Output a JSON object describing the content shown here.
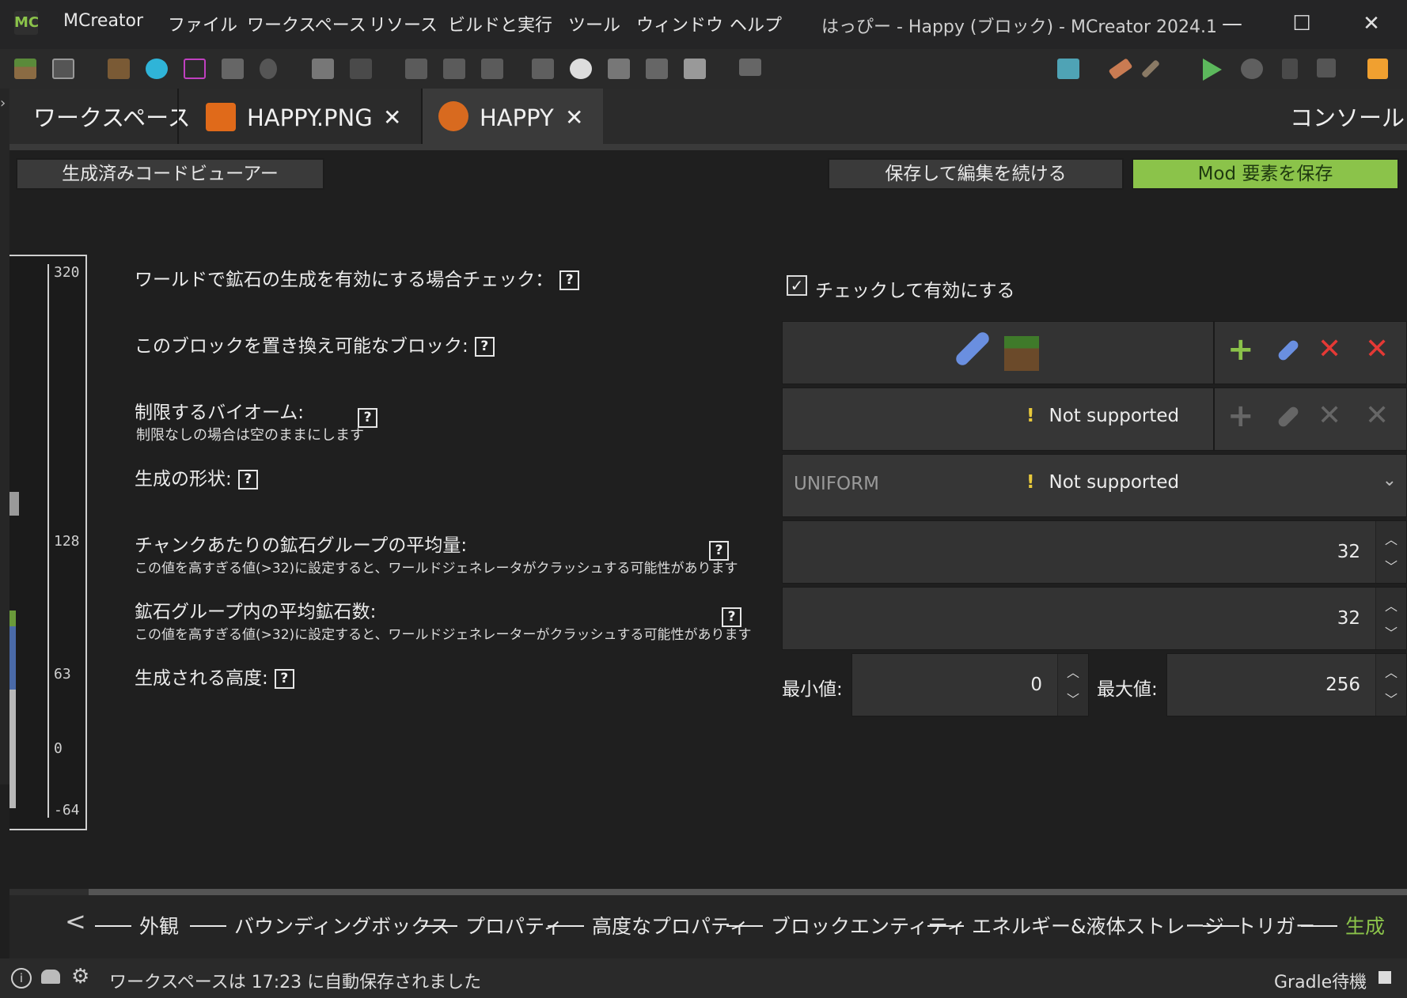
{
  "app": {
    "name": "MCreator",
    "window_title": "はっぴー - Happy (ブロック) - MCreator 2024.1",
    "logo": "MC"
  },
  "menu": [
    "ファイル",
    "ワークスペース",
    "リソース",
    "ビルドと実行",
    "ツール",
    "ウィンドウ",
    "ヘルプ"
  ],
  "window_controls": {
    "minimize": "—",
    "maximize": "☐",
    "close": "✕"
  },
  "tabs": {
    "workspace": "ワークスペース",
    "image": "HAPPY.PNG",
    "element": "HAPPY",
    "console": "コンソール",
    "close_glyph": "✕"
  },
  "actions": {
    "code_viewer": "生成済みコードビューアー",
    "save_continue": "保存して編集を続ける",
    "save_mod": "Mod 要素を保存"
  },
  "height_scale": [
    "320",
    "128",
    "63",
    "0",
    "-64"
  ],
  "form": {
    "enable_gen_label": "ワールドで鉱石の生成を有効にする場合チェック：",
    "enable_gen_checkbox_label": "チェックして有効にする",
    "enable_gen_checked": true,
    "replace_blocks_label": "このブロックを置き換え可能なブロック:",
    "biomes_label": "制限するバイオーム:",
    "biomes_sub": "制限なしの場合は空のままにします",
    "shape_label": "生成の形状:",
    "shape_value": "UNIFORM",
    "groups_label": "チャンクあたりの鉱石グループの平均量:",
    "groups_sub": "この値を高すぎる値(>32)に設定すると、ワールドジェネレータがクラッシュする可能性があります",
    "groups_value": "32",
    "size_label": "鉱石グループ内の平均鉱石数:",
    "size_sub": "この値を高すぎる値(>32)に設定すると、ワールドジェネレーターがクラッシュする可能性があります",
    "size_value": "32",
    "height_label": "生成される高度:",
    "min_label": "最小値:",
    "min_value": "0",
    "max_label": "最大値:",
    "max_value": "256",
    "not_supported": "Not supported",
    "help_glyph": "?",
    "warn_glyph": "!"
  },
  "nav": {
    "back": "<",
    "steps": [
      "外観",
      "バウンディングボックス",
      "プロパティ",
      "高度なプロパティ",
      "ブロックエンティティ",
      "エネルギー&液体ストレージ",
      "トリガー",
      "生成"
    ],
    "active_step": "生成"
  },
  "status": {
    "message": "ワークスペースは 17:23 に自動保存されました",
    "gradle": "Gradle待機"
  },
  "colors": {
    "accent_green": "#8bc34a",
    "danger_red": "#e53935",
    "warning_yellow": "#e8c93b",
    "background": "#1f1f1f"
  }
}
